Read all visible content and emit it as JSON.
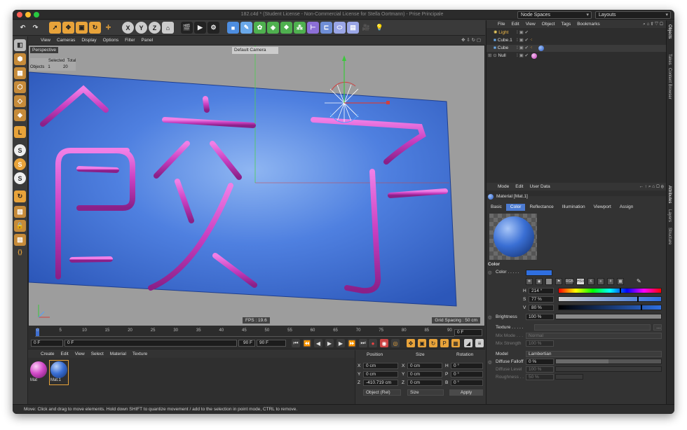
{
  "window": {
    "title": "182.c4d * (Student License - Non-Commercial License for Stella Oortmann) - Prise Principale"
  },
  "topbar": {
    "node_spaces": "Node Spaces",
    "layouts": "Layouts"
  },
  "viewport": {
    "menu": [
      "View",
      "Cameras",
      "Display",
      "Options",
      "Filter",
      "Panel"
    ],
    "label": "Perspective",
    "camera": "Default Camera",
    "stats_header_selected": "Selected",
    "stats_header_total": "Total",
    "stats_row_label": "Objects",
    "stats_selected": "1",
    "stats_total": "20",
    "fps": "FPS : 19.6",
    "grid_spacing": "Grid Spacing : 50 cm",
    "plane_color": "#3f6fd0",
    "tube_color": "#c83fc0"
  },
  "timeline": {
    "ticks": [
      "0",
      "5",
      "10",
      "15",
      "20",
      "25",
      "30",
      "35",
      "40",
      "45",
      "50",
      "55",
      "60",
      "65",
      "70",
      "75",
      "80",
      "85",
      "90"
    ],
    "end_frame": "0 F",
    "start_field": "0 F",
    "current_field": "0 F",
    "range_end": "90 F",
    "max_field": "90 F"
  },
  "materials": {
    "menu": [
      "Create",
      "Edit",
      "View",
      "Select",
      "Material",
      "Texture"
    ],
    "items": [
      {
        "name": "Mat"
      },
      {
        "name": "Mat.1"
      }
    ]
  },
  "coords": {
    "headers": {
      "position": "Position",
      "size": "Size",
      "rotation": "Rotation"
    },
    "rows": [
      {
        "axis": "X",
        "pos": "0 cm",
        "saxis": "X",
        "size": "0 cm",
        "raxis": "H",
        "rot": "0 °"
      },
      {
        "axis": "Y",
        "pos": "0 cm",
        "saxis": "Y",
        "size": "0 cm",
        "raxis": "P",
        "rot": "0 °"
      },
      {
        "axis": "Z",
        "pos": "-410.719 cm",
        "saxis": "Z",
        "size": "0 cm",
        "raxis": "B",
        "rot": "0 °"
      }
    ],
    "mode": "Object (Rel)",
    "size_mode": "Size",
    "apply": "Apply"
  },
  "objects": {
    "menu": [
      "File",
      "Edit",
      "View",
      "Object",
      "Tags",
      "Bookmarks"
    ],
    "items": [
      {
        "name": "Light"
      },
      {
        "name": "Cube.1"
      },
      {
        "name": "Cube"
      },
      {
        "name": "Null"
      }
    ]
  },
  "attributes": {
    "menu": [
      "Mode",
      "Edit",
      "User Data"
    ],
    "material_name": "Material [Mat.1]",
    "tabs": [
      "Basic",
      "Color",
      "Reflectance",
      "Illumination",
      "Viewport",
      "Assign"
    ],
    "active_tab": "Color",
    "section": "Color",
    "color_label": "Color . . . . .",
    "color_value": "#2f6fe0",
    "mode_buttons": [
      "RGB",
      "HSV",
      "K",
      "≡",
      "#",
      "▦"
    ],
    "h_label": "H",
    "h_value": "214 °",
    "h_fraction": 0.594,
    "s_label": "S",
    "s_value": "77 %",
    "s_fraction": 0.77,
    "v_label": "V",
    "v_value": "80 %",
    "v_fraction": 0.8,
    "brightness_label": "Brightness",
    "brightness_value": "100 %",
    "brightness_fraction": 1.0,
    "texture_label": "Texture . . . . .",
    "mix_mode_label": "Mix Mode . . .",
    "mix_mode_value": "Normal",
    "mix_strength_label": "Mix Strength",
    "mix_strength_value": "100 %",
    "model_label": "Model",
    "model_value": "Lambertian",
    "diffuse_falloff_label": "Diffuse Falloff",
    "diffuse_falloff_value": "0 %",
    "diffuse_level_label": "Diffuse Level",
    "diffuse_level_value": "100 %",
    "roughness_label": "Roughness . .",
    "roughness_value": "50 %"
  },
  "side_tabs": [
    "Objects",
    "Takes",
    "Content Browser",
    "Attributes",
    "Layers",
    "Structure"
  ],
  "status": "Move: Click and drag to move elements. Hold down SHIFT to quantize movement / add to the selection in point mode, CTRL to remove."
}
